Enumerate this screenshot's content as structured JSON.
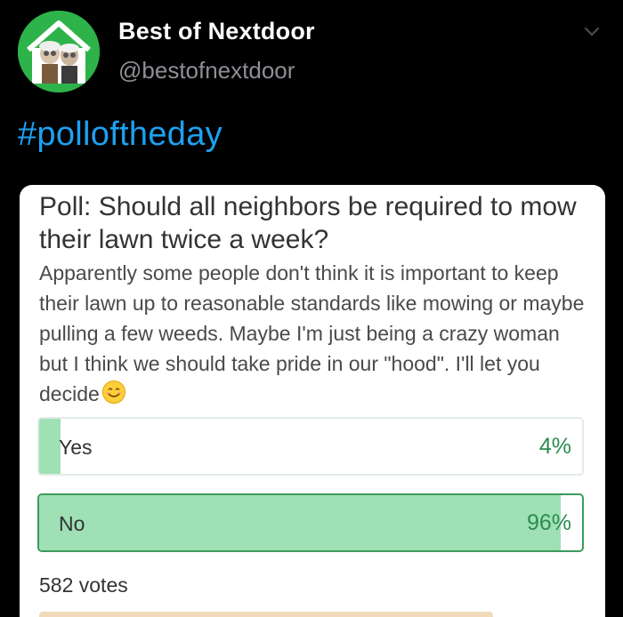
{
  "tweet": {
    "display_name": "Best of Nextdoor",
    "handle": "@bestofnextdoor",
    "hashtag": "#polloftheday",
    "avatar_icon": "house-muppets-logo",
    "menu_icon": "chevron-down-icon"
  },
  "poll": {
    "title": "Poll: Should all neighbors be required to mow their lawn twice a week?",
    "body": "Apparently some people don't think it is important to keep their lawn up to reasonable standards like mowing or maybe pulling a few weeds. Maybe I'm just being a crazy woman but I think we should take pride in our \"hood\". I'll let you decide",
    "emoji_icon": "smiling-face-emoji",
    "options": [
      {
        "label": "Yes",
        "percent_text": "4%",
        "percent": 4,
        "selected": false
      },
      {
        "label": "No",
        "percent_text": "96%",
        "percent": 96,
        "selected": true
      }
    ],
    "votes": "582 votes"
  },
  "colors": {
    "background": "#000000",
    "link_blue": "#1da1f2",
    "nextdoor_green": "#2eb34a",
    "poll_fill": "#9fe0b5",
    "poll_percent": "#2c8b4e"
  }
}
